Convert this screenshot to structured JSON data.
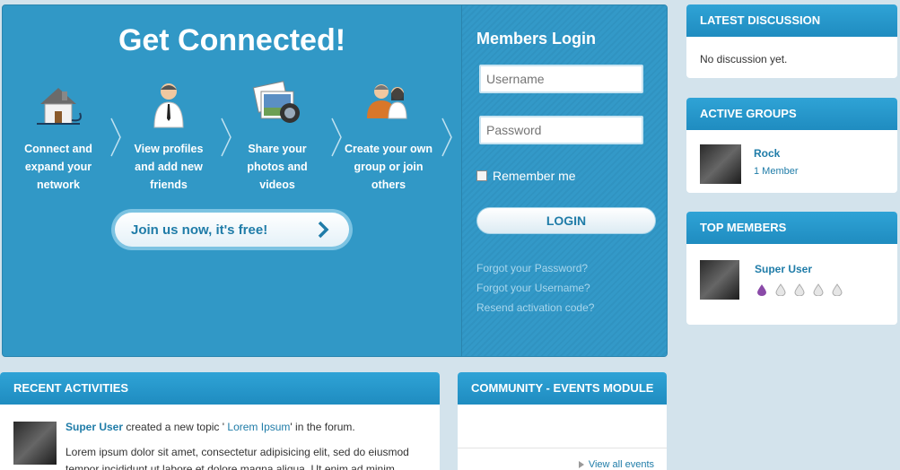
{
  "hero": {
    "title": "Get Connected!",
    "steps": [
      {
        "icon": "house-network-icon",
        "label": "Connect and expand your network"
      },
      {
        "icon": "person-profile-icon",
        "label": "View profiles and add new friends"
      },
      {
        "icon": "photos-camera-icon",
        "label": "Share your photos and videos"
      },
      {
        "icon": "group-people-icon",
        "label": "Create your own group or join others"
      }
    ],
    "join_label": "Join us now, it's free!"
  },
  "login": {
    "title": "Members Login",
    "username_placeholder": "Username",
    "password_placeholder": "Password",
    "remember_label": "Remember me",
    "login_label": "LOGIN",
    "links": [
      "Forgot your Password?",
      "Forgot your Username?",
      "Resend activation code?"
    ]
  },
  "sidebar": {
    "latest": {
      "title": "LATEST DISCUSSION",
      "text": "No discussion yet."
    },
    "groups": {
      "title": "ACTIVE GROUPS",
      "name": "Rock",
      "members": "1 Member"
    },
    "top": {
      "title": "TOP MEMBERS",
      "name": "Super User"
    }
  },
  "activities": {
    "title": "RECENT ACTIVITIES",
    "user": "Super User",
    "action_prefix": " created a new topic '",
    "topic": " Lorem Ipsum",
    "action_suffix": "' in the forum.",
    "body_line1": "Lorem ipsum dolor sit amet, consectetur adipisicing elit, sed do eiusmod",
    "body_line2": "tempor incididunt ut labore et dolore magna aliqua. Ut enim ad minim"
  },
  "events": {
    "title": "COMMUNITY - EVENTS MODULE",
    "view_all": "View all events"
  },
  "colors": {
    "accent": "#3198c6",
    "link": "#1f7ca8",
    "page_bg": "#d3e3ec"
  }
}
